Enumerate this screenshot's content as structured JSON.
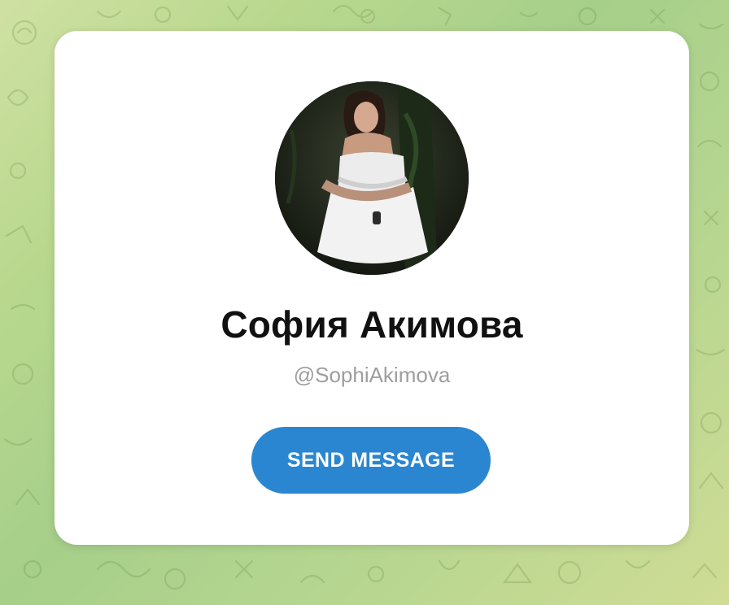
{
  "background": {
    "pattern_icon": "doodle-pattern-icon",
    "colors": [
      "#cfe1a3",
      "#a6cf8a",
      "#cfdc95"
    ]
  },
  "profile": {
    "name": "София Акимова",
    "username": "@SophiAkimova",
    "avatar_icon": "profile-photo"
  },
  "actions": {
    "send_message_label": "SEND MESSAGE"
  },
  "theme": {
    "accent": "#2a86d0",
    "card": "#ffffff",
    "name_color": "#111111",
    "username_color": "#9e9e9e"
  }
}
